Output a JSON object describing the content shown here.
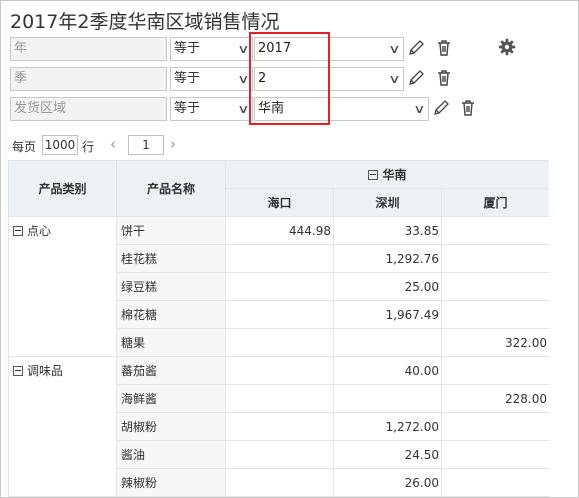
{
  "title": "2017年2季度华南区域销售情况",
  "filters": [
    {
      "field_placeholder": "年",
      "operator": "等于",
      "value": "2017"
    },
    {
      "field_placeholder": "季",
      "operator": "等于",
      "value": "2"
    },
    {
      "field_placeholder": "发货区域",
      "operator": "等于",
      "value": "华南"
    }
  ],
  "pager": {
    "per_page_label": "每页",
    "per_page": "1000",
    "row_label": "行",
    "prev": "‹",
    "page": "1",
    "next": "›"
  },
  "table": {
    "col_category": "产品类别",
    "col_name": "产品名称",
    "region": "华南",
    "cities": [
      "海口",
      "深圳",
      "厦门"
    ],
    "groups": [
      {
        "category": "点心",
        "rows": [
          {
            "name": "饼干",
            "values": [
              "444.98",
              "33.85",
              ""
            ]
          },
          {
            "name": "桂花糕",
            "values": [
              "",
              "1,292.76",
              ""
            ]
          },
          {
            "name": "绿豆糕",
            "values": [
              "",
              "25.00",
              ""
            ]
          },
          {
            "name": "棉花糖",
            "values": [
              "",
              "1,967.49",
              ""
            ]
          },
          {
            "name": "糖果",
            "values": [
              "",
              "",
              "322.00"
            ]
          }
        ]
      },
      {
        "category": "调味品",
        "rows": [
          {
            "name": "蕃茄酱",
            "values": [
              "",
              "40.00",
              ""
            ]
          },
          {
            "name": "海鲜酱",
            "values": [
              "",
              "",
              "228.00"
            ]
          },
          {
            "name": "胡椒粉",
            "values": [
              "",
              "1,272.00",
              ""
            ]
          },
          {
            "name": "酱油",
            "values": [
              "",
              "24.50",
              ""
            ]
          },
          {
            "name": "辣椒粉",
            "values": [
              "",
              "26.00",
              ""
            ]
          }
        ]
      }
    ]
  },
  "colors": {
    "highlight": "#e0242a",
    "header_bg": "#eef1f4",
    "border": "#e1e5ea"
  },
  "icons": {
    "edit": "pencil-icon",
    "delete": "trash-icon",
    "settings": "gear-icon",
    "expand": "minus-box-icon",
    "dropdown": "chevron-down-icon"
  }
}
